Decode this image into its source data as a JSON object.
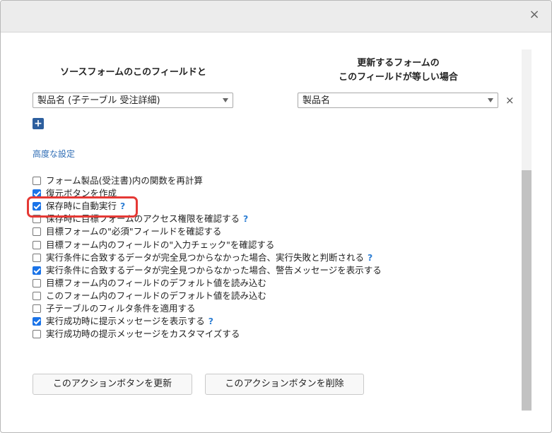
{
  "dialog": {
    "close_label": "×"
  },
  "columns": {
    "source_heading": "ソースフォームのこのフィールドと",
    "target_heading_line1": "更新するフォームの",
    "target_heading_line2": "このフィールドが等しい場合"
  },
  "mapping": {
    "source_field_value": "製品名 (子テーブル 受注詳細)",
    "target_field_value": "製品名",
    "remove_label": "×",
    "add_label": "+"
  },
  "advanced": {
    "link_label": "高度な設定"
  },
  "options": [
    {
      "label": "フォーム製品(受注書)内の関数を再計算",
      "checked": false,
      "help": false
    },
    {
      "label": "復元ボタンを作成",
      "checked": true,
      "help": false
    },
    {
      "label": "保存時に自動実行",
      "checked": true,
      "help": true
    },
    {
      "label": "保存時に目標フォームのアクセス権限を確認する",
      "checked": false,
      "help": true
    },
    {
      "label": "目標フォームの\"必須\"フィールドを確認する",
      "checked": false,
      "help": false
    },
    {
      "label": "目標フォーム内のフィールドの\"入力チェック\"を確認する",
      "checked": false,
      "help": false
    },
    {
      "label": "実行条件に合致するデータが完全見つからなかった場合、実行失敗と判断される",
      "checked": false,
      "help": true
    },
    {
      "label": "実行条件に合致するデータが完全見つからなかった場合、警告メッセージを表示する",
      "checked": true,
      "help": false
    },
    {
      "label": "目標フォーム内のフィールドのデフォルト値を読み込む",
      "checked": false,
      "help": false
    },
    {
      "label": "このフォーム内のフィールドのデフォルト値を読み込む",
      "checked": false,
      "help": false
    },
    {
      "label": "子テーブルのフィルタ条件を適用する",
      "checked": false,
      "help": false
    },
    {
      "label": "実行成功時に提示メッセージを表示する",
      "checked": true,
      "help": true
    },
    {
      "label": "実行成功時の提示メッセージをカスタマイズする",
      "checked": false,
      "help": false
    }
  ],
  "help_glyph": "?",
  "buttons": {
    "update_label": "このアクションボタンを更新",
    "delete_label": "このアクションボタンを削除"
  },
  "colors": {
    "accent": "#1a73e8",
    "highlight": "#e53935",
    "link": "#2f6db5"
  }
}
